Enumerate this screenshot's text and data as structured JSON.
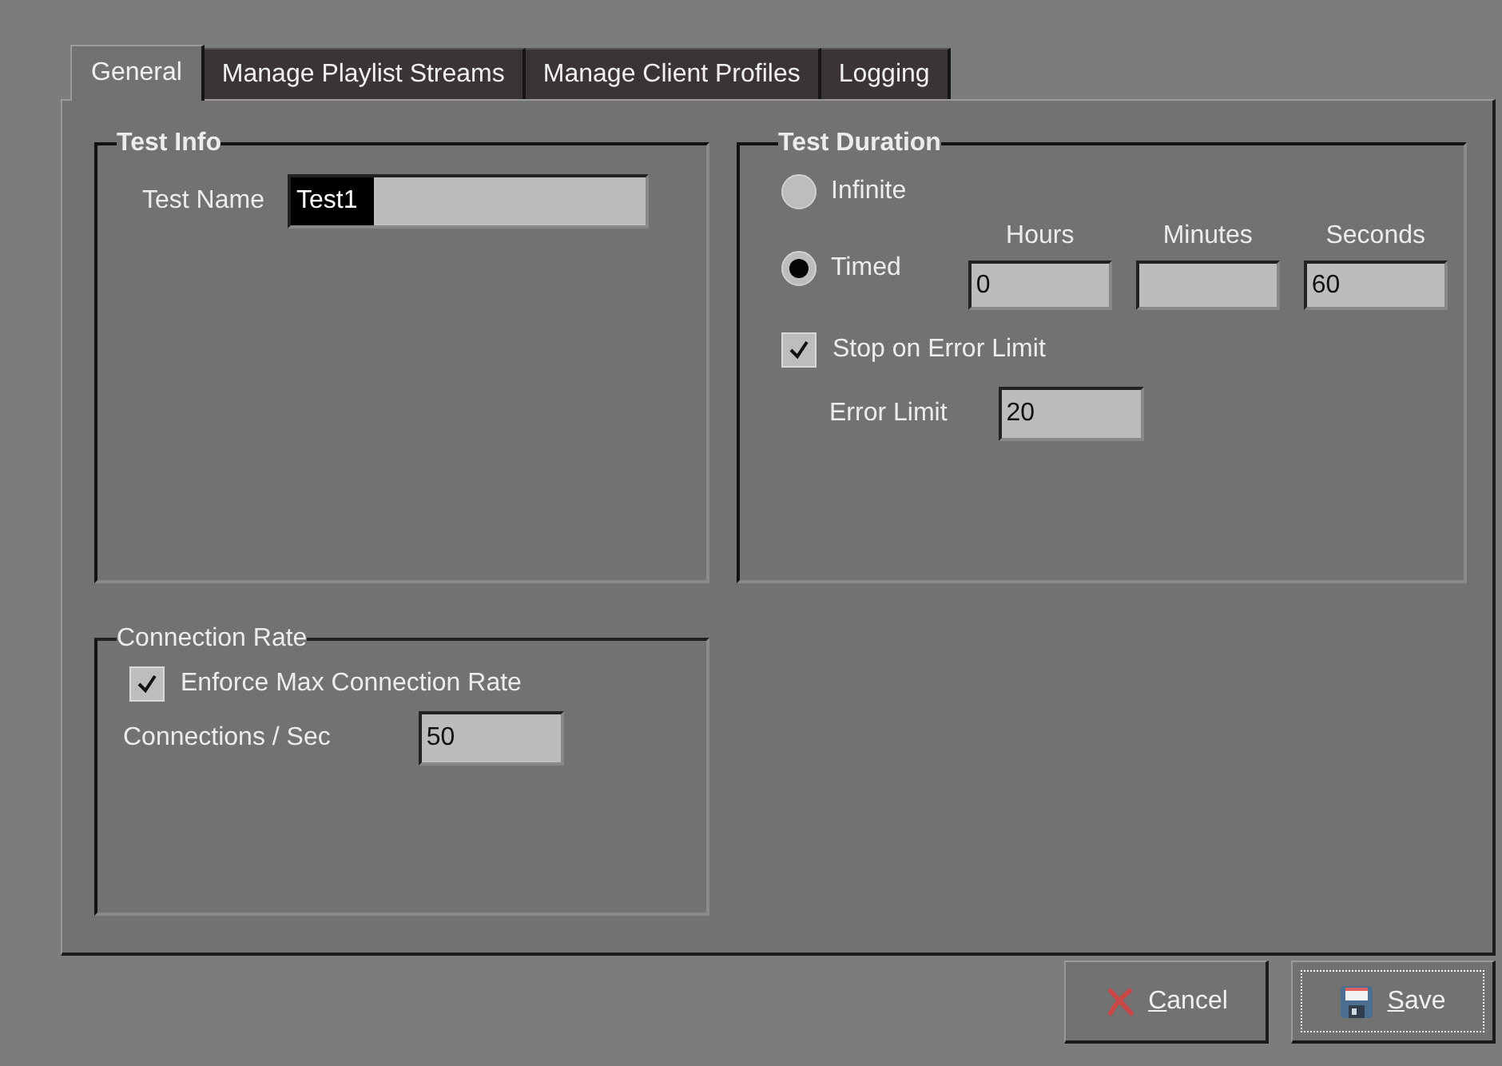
{
  "tabs": [
    {
      "label": "General",
      "selected": true
    },
    {
      "label": "Manage Playlist Streams",
      "selected": false
    },
    {
      "label": "Manage Client Profiles",
      "selected": false
    },
    {
      "label": "Logging",
      "selected": false
    }
  ],
  "test_info": {
    "title": "Test Info",
    "test_name": {
      "label": "Test Name",
      "value": "Test1",
      "text_selected": true
    }
  },
  "test_duration": {
    "title": "Test Duration",
    "modes": [
      {
        "label": "Infinite",
        "selected": false
      },
      {
        "label": "Timed",
        "selected": true
      }
    ],
    "time_fields": [
      {
        "label": "Hours",
        "value": "0"
      },
      {
        "label": "Minutes"
      },
      {
        "label": "Seconds",
        "value": "60"
      }
    ],
    "stop_on_error": {
      "label": "Stop on Error Limit",
      "checked": true
    },
    "error_limit": {
      "label": "Error Limit",
      "value": "20"
    }
  },
  "connection_rate": {
    "title": "Connection Rate",
    "enforce": {
      "label": "Enforce Max Connection Rate",
      "checked": true
    },
    "per_sec": {
      "label": "Connections / Sec",
      "value": "50"
    }
  },
  "buttons": [
    {
      "kind": "cancel",
      "label": "Cancel",
      "focused": false
    },
    {
      "kind": "save",
      "label": "Save",
      "focused": true
    }
  ]
}
